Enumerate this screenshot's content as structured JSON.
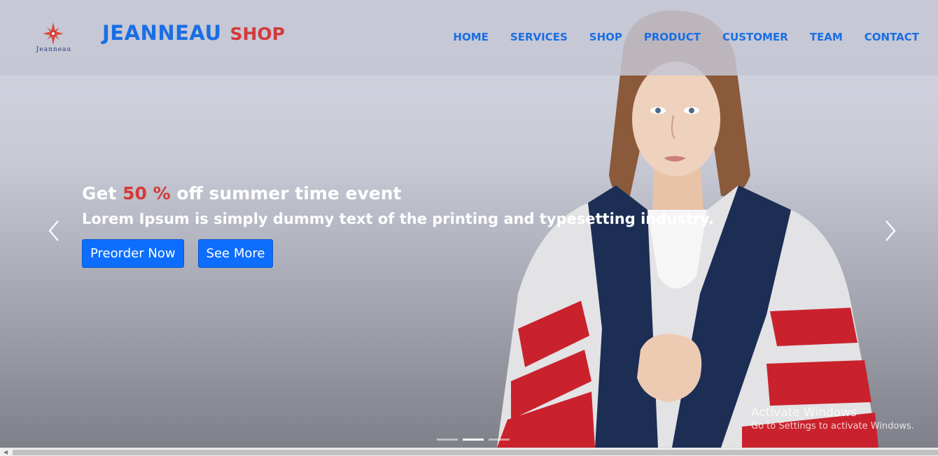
{
  "brand": {
    "logo_text": "Jeanneau",
    "name_main": "JEANNEAU",
    "name_accent": "SHOP"
  },
  "nav": {
    "items": [
      {
        "label": "HOME"
      },
      {
        "label": "SERVICES"
      },
      {
        "label": "SHOP"
      },
      {
        "label": "PRODUCT"
      },
      {
        "label": "CUSTOMER"
      },
      {
        "label": "TEAM"
      },
      {
        "label": "CONTACT"
      }
    ]
  },
  "hero": {
    "headline_prefix": "Get ",
    "headline_highlight": "50 %",
    "headline_suffix": " off summer time event",
    "subheadline": "Lorem Ipsum is simply dummy text of the printing and typesetting industry.",
    "primary_button": "Preorder Now",
    "secondary_button": "See More",
    "active_slide": 2,
    "slide_count": 3
  },
  "watermark": {
    "title": "Activate Windows",
    "subtitle": "Go to Settings to activate Windows."
  },
  "colors": {
    "brand_blue": "#1a6ee3",
    "accent_red": "#d43a3a",
    "button_blue": "#0d6efd"
  },
  "icons": {
    "logo": "compass-star-icon",
    "prev": "chevron-left-icon",
    "next": "chevron-right-icon",
    "scroll_left": "scroll-left-arrow-icon"
  }
}
